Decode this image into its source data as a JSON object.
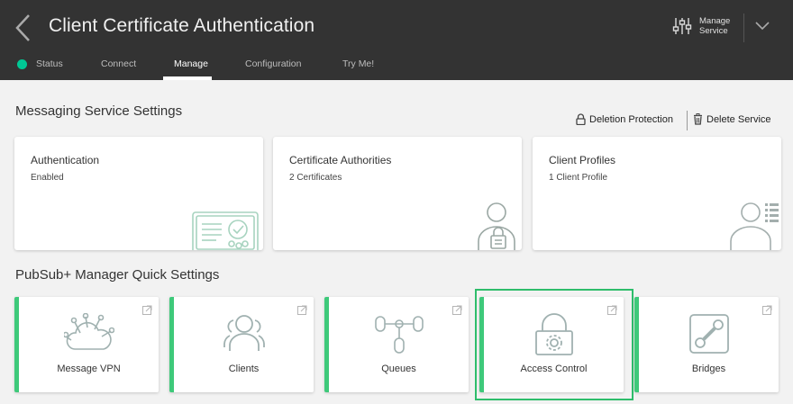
{
  "header": {
    "title": "Client Certificate Authentication",
    "manage_service": [
      "Manage",
      "Service"
    ]
  },
  "tabs": [
    {
      "label": "Status",
      "active": false
    },
    {
      "label": "Connect",
      "active": false
    },
    {
      "label": "Manage",
      "active": true
    },
    {
      "label": "Configuration",
      "active": false
    },
    {
      "label": "Try Me!",
      "active": false
    }
  ],
  "status_color": "#00c895",
  "messaging": {
    "title": "Messaging Service Settings",
    "deletion_protection": "Deletion Protection",
    "delete_service": "Delete Service",
    "cards": [
      {
        "title": "Authentication",
        "subtitle": "Enabled",
        "icon": "certificate-icon"
      },
      {
        "title": "Certificate Authorities",
        "subtitle": "2 Certificates",
        "icon": "user-lock-icon"
      },
      {
        "title": "Client Profiles",
        "subtitle": "1 Client Profile",
        "icon": "user-list-icon"
      }
    ]
  },
  "quick": {
    "title": "PubSub+ Manager Quick Settings",
    "accent": "#3ec97a",
    "cards": [
      {
        "label": "Message VPN",
        "icon": "cloud-network-icon"
      },
      {
        "label": "Clients",
        "icon": "users-icon"
      },
      {
        "label": "Queues",
        "icon": "queues-icon"
      },
      {
        "label": "Access Control",
        "icon": "lock-gear-icon",
        "highlighted": true
      },
      {
        "label": "Bridges",
        "icon": "bridge-icon"
      }
    ]
  }
}
